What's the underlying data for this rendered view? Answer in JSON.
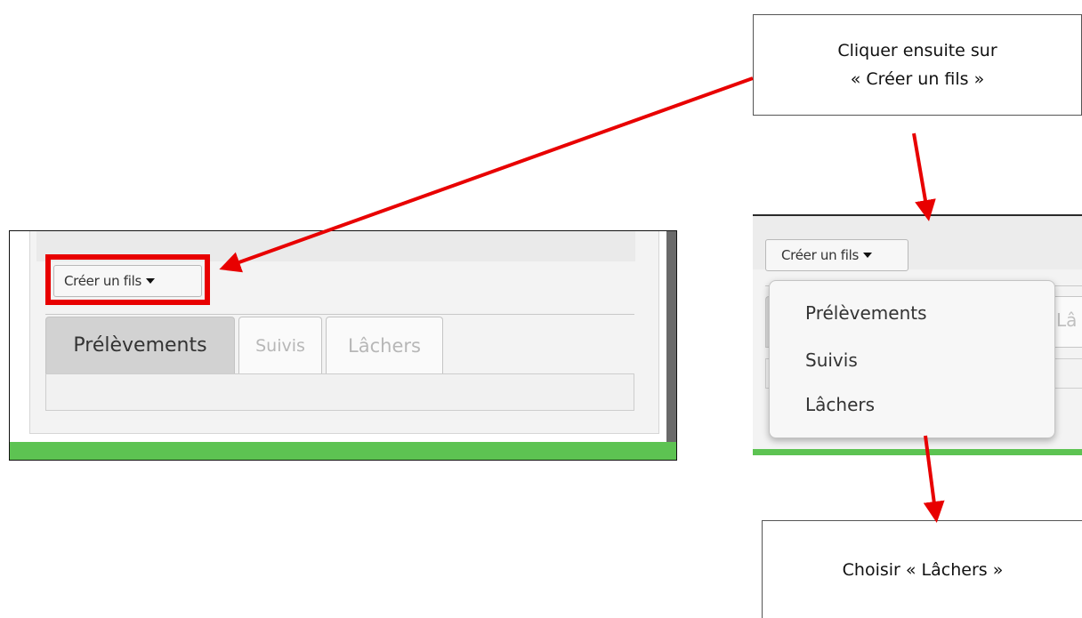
{
  "annotations": {
    "top_callout": {
      "line1": "Cliquer ensuite sur",
      "line2": "« Créer un fils »"
    },
    "bottom_callout": {
      "text": "Choisir « Lâchers »"
    }
  },
  "left_screenshot": {
    "create_button": {
      "label": "Créer un fils"
    },
    "tabs": [
      {
        "label": "Prélèvements",
        "state": "active"
      },
      {
        "label": "Suivis",
        "state": "disabled"
      },
      {
        "label": "Lâchers",
        "state": "disabled"
      }
    ]
  },
  "right_screenshot": {
    "create_button": {
      "label": "Créer un fils"
    },
    "partial_tab_text": "Lâ",
    "dropdown_items": [
      "Prélèvements",
      "Suivis",
      "Lâchers"
    ]
  },
  "colors": {
    "highlight": "#e80000",
    "arrow": "#e80000",
    "frame_green": "#5dc352",
    "active_tab": "#d2d2d2"
  },
  "icons": [
    "caret-down-icon",
    "arrow-icon"
  ]
}
